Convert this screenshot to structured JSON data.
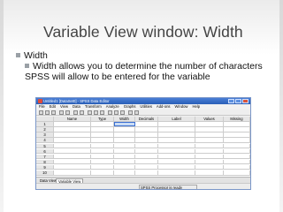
{
  "slide": {
    "title": "Variable View window: Width",
    "bullet_1": "Width",
    "bullet_2": "Width allows you to determine the number of characters SPSS will allow to be entered for the variable"
  },
  "spss": {
    "window_title": "Untitled1 [DataSet0] - SPSS Data Editor",
    "menu": [
      "File",
      "Edit",
      "View",
      "Data",
      "Transform",
      "Analyze",
      "Graphs",
      "Utilities",
      "Add-ons",
      "Window",
      "Help"
    ],
    "columns": [
      "",
      "Name",
      "Type",
      "Width",
      "Decimals",
      "Label",
      "Values",
      "Missing"
    ],
    "row_numbers": [
      "1",
      "2",
      "3",
      "4",
      "5",
      "6",
      "7",
      "8",
      "9",
      "10"
    ],
    "tabs": {
      "data_view": "Data View",
      "variable_view": "Variable View"
    },
    "status": "SPSS Processor is ready"
  },
  "colors": {
    "title_text": "#444444",
    "bullet": "#9aa0a6",
    "titlebar": "#2a5fb8",
    "selection": "#c9dcf5"
  }
}
